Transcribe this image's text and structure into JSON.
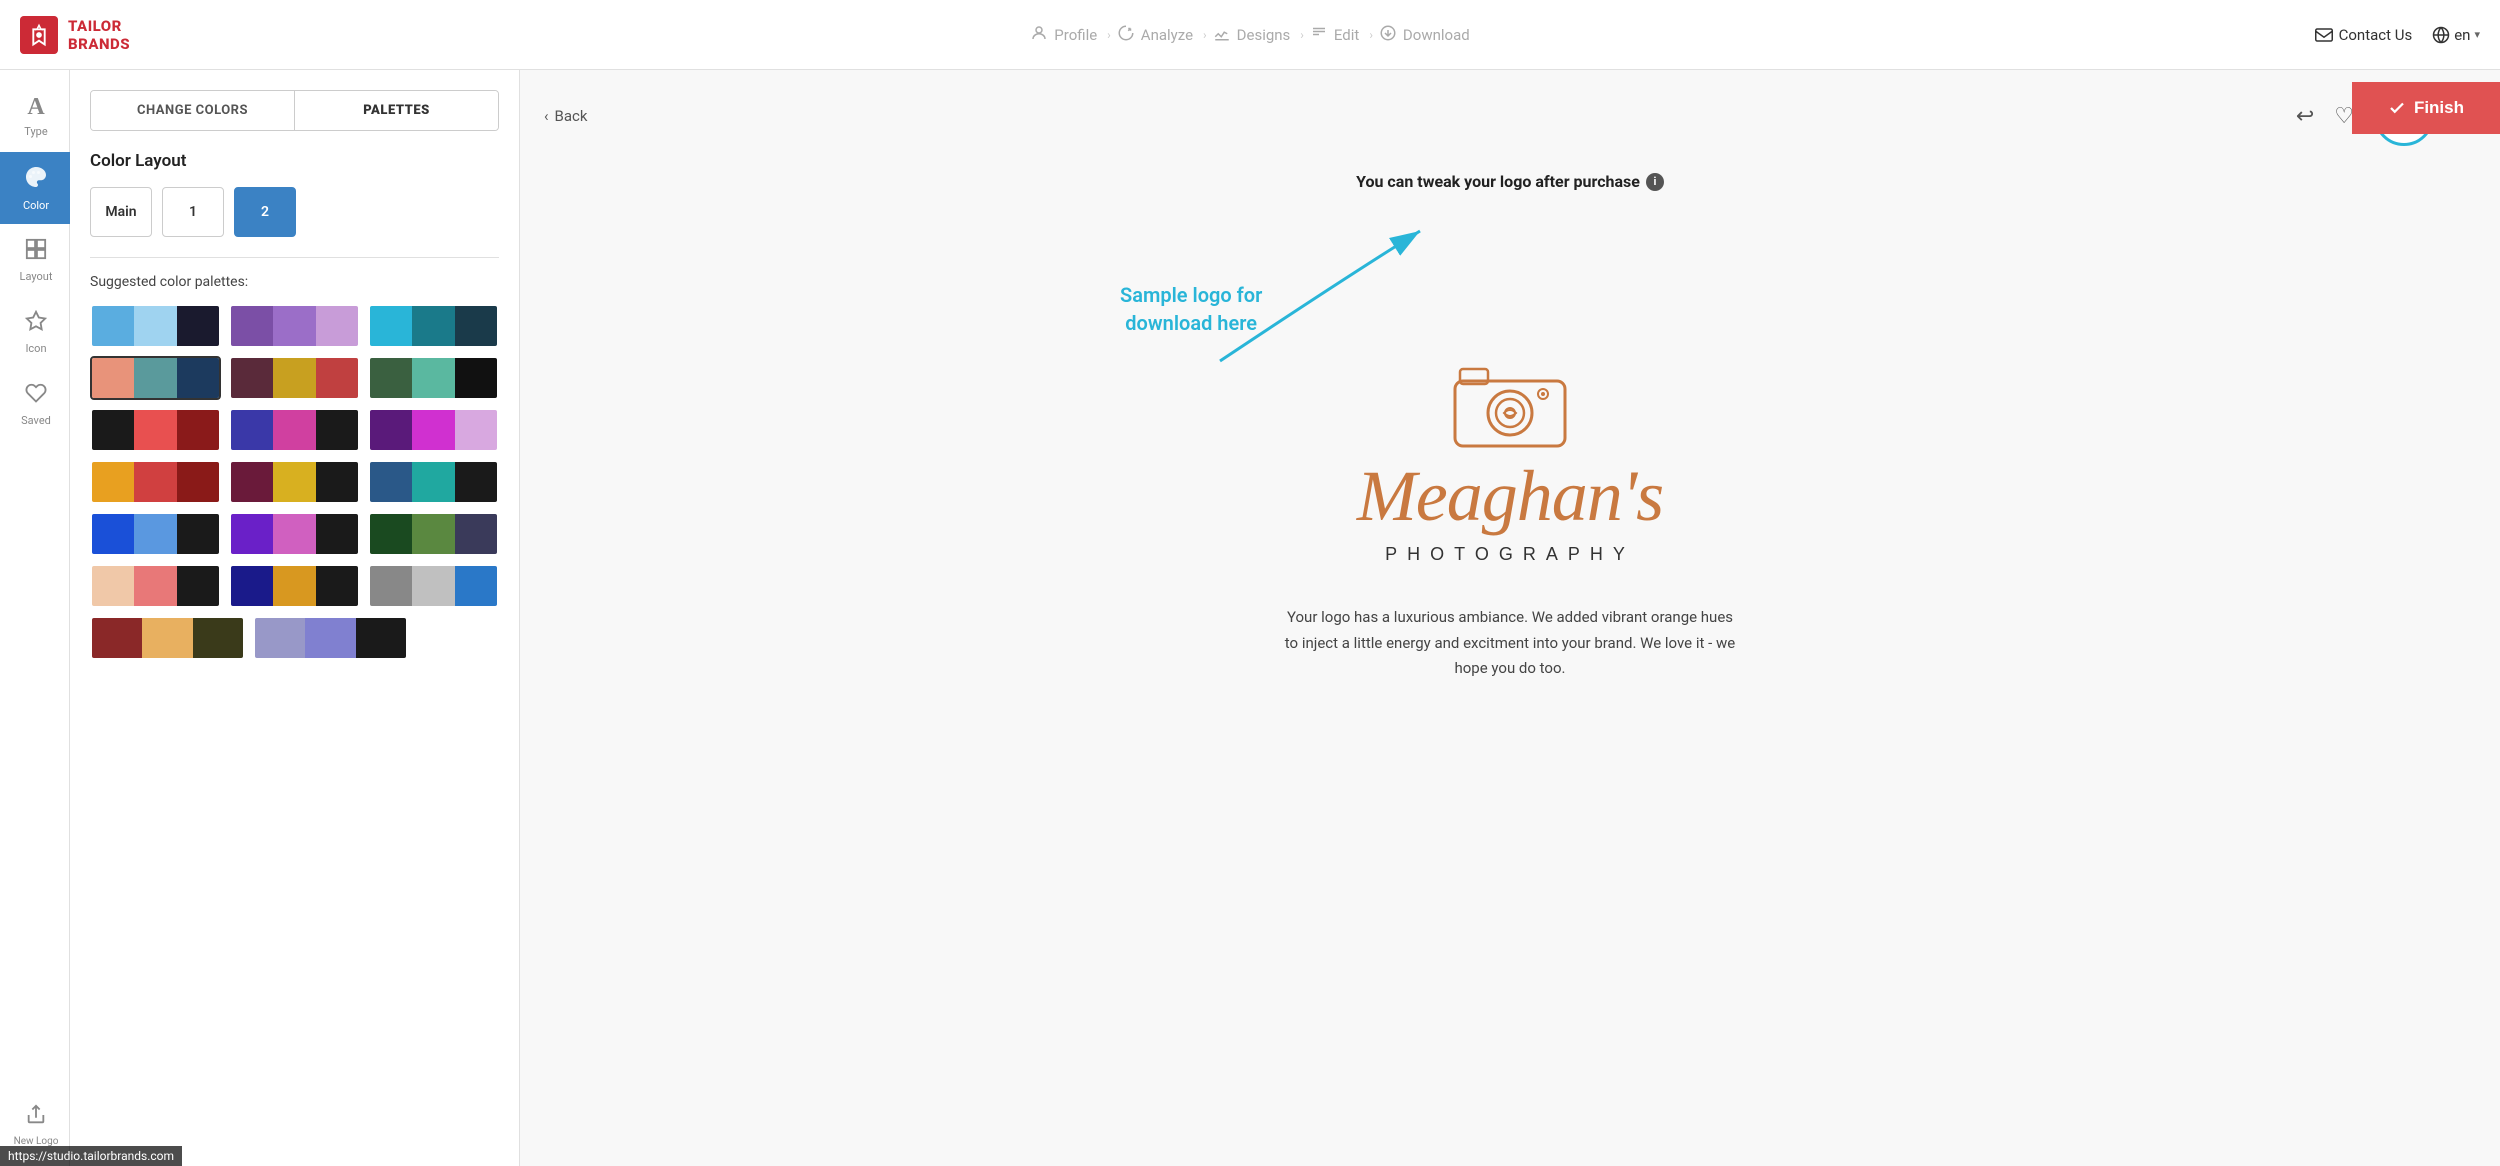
{
  "brand": {
    "name_line1": "TAILOR",
    "name_line2": "BRANDS",
    "logo_alt": "Tailor Brands Logo"
  },
  "header": {
    "steps": [
      {
        "id": "profile",
        "label": "Profile",
        "icon": "👤",
        "active": false
      },
      {
        "id": "analyze",
        "label": "Analyze",
        "icon": "🔧",
        "active": false
      },
      {
        "id": "designs",
        "label": "Designs",
        "icon": "✏️",
        "active": false
      },
      {
        "id": "edit",
        "label": "Edit",
        "icon": "⚙️",
        "active": false
      },
      {
        "id": "download",
        "label": "Download",
        "icon": "⬇️",
        "active": false
      }
    ],
    "contact_us": "Contact Us",
    "language": "en"
  },
  "sidebar": {
    "items": [
      {
        "id": "type",
        "label": "Type",
        "icon": "A",
        "active": false
      },
      {
        "id": "color",
        "label": "Color",
        "active": true
      },
      {
        "id": "layout",
        "label": "Layout",
        "active": false
      },
      {
        "id": "icon",
        "label": "Icon",
        "active": false
      },
      {
        "id": "saved",
        "label": "Saved",
        "active": false
      },
      {
        "id": "new-logo",
        "label": "New Logo",
        "active": false
      }
    ]
  },
  "panel": {
    "tabs": [
      {
        "id": "change-colors",
        "label": "CHANGE COLORS",
        "active": false
      },
      {
        "id": "palettes",
        "label": "PALETTES",
        "active": true
      }
    ],
    "color_layout": {
      "title": "Color Layout",
      "options": [
        {
          "id": "main",
          "label": "Main",
          "active": false
        },
        {
          "id": "1",
          "label": "1",
          "active": false
        },
        {
          "id": "2",
          "label": "2",
          "active": true
        }
      ]
    },
    "suggested_title": "Suggested color palettes:",
    "palettes": [
      {
        "row": 1,
        "swatches": [
          {
            "id": "p1",
            "selected": false,
            "colors": [
              "#5aade0",
              "#9fd3f0",
              "#1a1a2e"
            ]
          },
          {
            "id": "p2",
            "selected": false,
            "colors": [
              "#7b4fa6",
              "#9b6ec8",
              "#c89cd8"
            ]
          },
          {
            "id": "p3",
            "selected": false,
            "colors": [
              "#29b5d8",
              "#1a7a8a",
              "#1a3a4a"
            ]
          }
        ]
      },
      {
        "row": 2,
        "swatches": [
          {
            "id": "p4",
            "selected": true,
            "colors": [
              "#e8937a",
              "#5a9a9c",
              "#1c3a5e"
            ]
          },
          {
            "id": "p5",
            "selected": false,
            "colors": [
              "#5a2a3a",
              "#c8a020",
              "#c04040"
            ]
          },
          {
            "id": "p6",
            "selected": false,
            "colors": [
              "#3a6040",
              "#5ab8a0",
              "#111111"
            ]
          }
        ]
      },
      {
        "row": 3,
        "swatches": [
          {
            "id": "p7",
            "selected": false,
            "colors": [
              "#1a1a1a",
              "#e85050",
              "#8a1a1a"
            ]
          },
          {
            "id": "p8",
            "selected": false,
            "colors": [
              "#3a38a8",
              "#d040a0",
              "#1a1a1a"
            ]
          },
          {
            "id": "p9",
            "selected": false,
            "colors": [
              "#5a1a7a",
              "#d030d0",
              "#d8a8e0"
            ]
          }
        ]
      },
      {
        "row": 4,
        "swatches": [
          {
            "id": "p10",
            "selected": false,
            "colors": [
              "#e8a020",
              "#d04040",
              "#8a1a18"
            ]
          },
          {
            "id": "p11",
            "selected": false,
            "colors": [
              "#6a1a3a",
              "#d8b020",
              "#1a1a1a"
            ]
          },
          {
            "id": "p12",
            "selected": false,
            "colors": [
              "#2a5888",
              "#20a8a0",
              "#1a1a1a"
            ]
          }
        ]
      },
      {
        "row": 5,
        "swatches": [
          {
            "id": "p13",
            "selected": false,
            "colors": [
              "#1a50d8",
              "#5a98e0",
              "#1a1a1a"
            ]
          },
          {
            "id": "p14",
            "selected": false,
            "colors": [
              "#6a20c8",
              "#d060c0",
              "#1a1a1a"
            ]
          },
          {
            "id": "p15",
            "selected": false,
            "colors": [
              "#1a4a20",
              "#5a8840",
              "#3a3a5a"
            ]
          }
        ]
      },
      {
        "row": 6,
        "swatches": [
          {
            "id": "p16",
            "selected": false,
            "colors": [
              "#f0c8a8",
              "#e87878",
              "#1a1a1a"
            ]
          },
          {
            "id": "p17",
            "selected": false,
            "colors": [
              "#1a1a8a",
              "#d89820",
              "#1a1a1a"
            ]
          },
          {
            "id": "p18",
            "selected": false,
            "colors": [
              "#888888",
              "#c0c0c0",
              "#2a78c8"
            ]
          }
        ]
      },
      {
        "row": 7,
        "swatches": [
          {
            "id": "p19",
            "selected": false,
            "colors": [
              "#8a2828",
              "#e8b060",
              "#3a3a1a"
            ]
          },
          {
            "id": "p20",
            "selected": false,
            "colors": [
              "#9898c8",
              "#8080d0",
              "#1a1a1a"
            ]
          }
        ]
      }
    ]
  },
  "canvas": {
    "back_label": "Back",
    "tweak_notice": "You can tweak your logo after purchase",
    "sample_logo_label": "Sample logo for\ndownload here",
    "toolbar_icons": {
      "undo": "↩",
      "heart": "♡",
      "settings": "⊙",
      "share": "↗"
    },
    "finish_button": "Finish",
    "logo": {
      "business_name": "Meaghan's",
      "tagline": "PHOTOGRAPHY",
      "description": "Your logo has a luxurious ambiance. We added vibrant orange hues to inject a little energy and excitment into your brand. We love it - we hope you do too."
    }
  },
  "url_bar": "https://studio.tailorbrands.com"
}
